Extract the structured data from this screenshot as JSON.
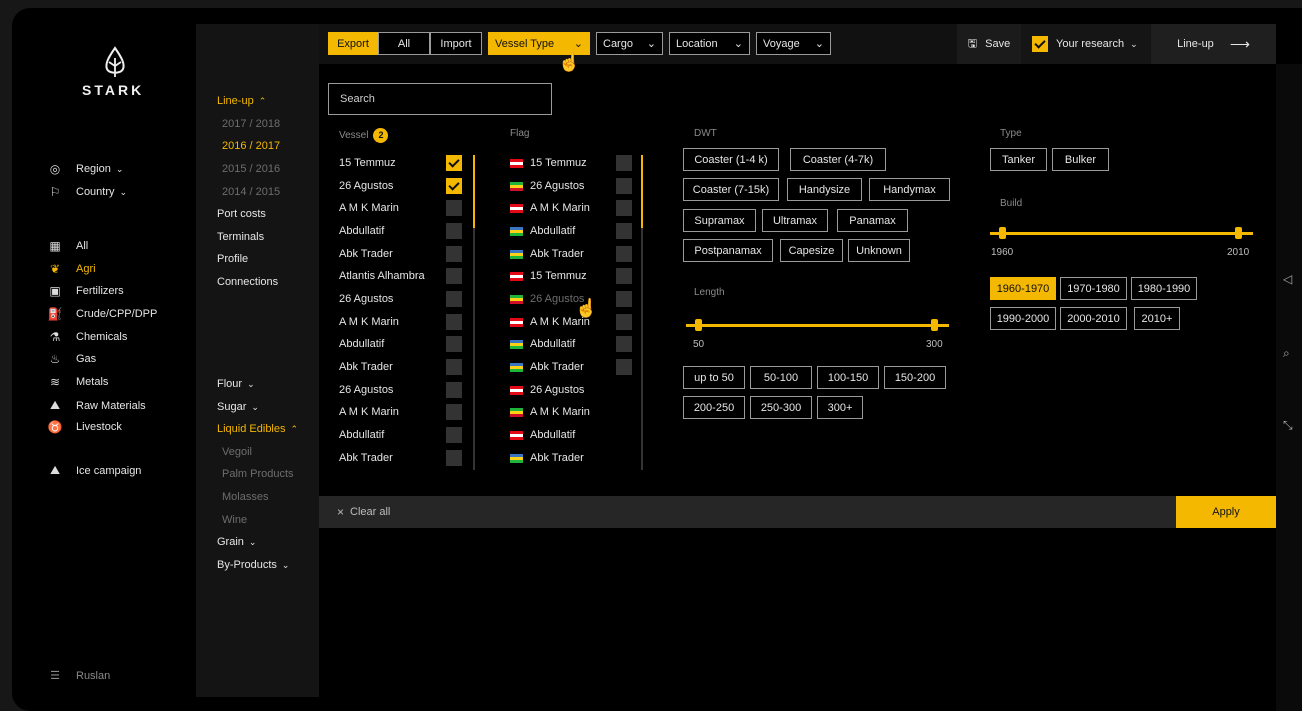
{
  "brand": {
    "name": "STARK"
  },
  "sidebar": {
    "region": "Region",
    "country": "Country",
    "items": [
      {
        "label": "All",
        "icon": "grid-icon"
      },
      {
        "label": "Agri",
        "icon": "wheat-icon"
      },
      {
        "label": "Fertilizers",
        "icon": "sack-icon"
      },
      {
        "label": "Crude/CPP/DPP",
        "icon": "oil-icon"
      },
      {
        "label": "Chemicals",
        "icon": "flask-icon"
      },
      {
        "label": "Gas",
        "icon": "flame-icon"
      },
      {
        "label": "Metals",
        "icon": "bars-icon"
      },
      {
        "label": "Raw Materials",
        "icon": "pile-icon"
      },
      {
        "label": "Livestock",
        "icon": "cow-icon"
      }
    ],
    "campaign": "Ice campaign",
    "user": "Ruslan"
  },
  "col2": {
    "lineup": "Line-up",
    "years": [
      "2017 / 2018",
      "2016 / 2017",
      "2015 / 2016",
      "2014 / 2015"
    ],
    "links": [
      "Port costs",
      "Terminals",
      "Profile",
      "Connections"
    ],
    "flour": "Flour",
    "sugar": "Sugar",
    "liquid": "Liquid Edibles",
    "liquid_items": [
      "Vegoil",
      "Palm Products",
      "Molasses",
      "Wine"
    ],
    "grain": "Grain",
    "byproducts": "By-Products"
  },
  "toolbar": {
    "export": "Export",
    "all": "All",
    "import": "Import",
    "vessel_type": "Vessel Type",
    "cargo": "Cargo",
    "location": "Location",
    "voyage": "Voyage",
    "save": "Save",
    "research": "Your research",
    "lineup": "Line-up"
  },
  "filters": {
    "search_placeholder": "Search",
    "vessel_header": "Vessel",
    "vessel_count": "2",
    "vessels": [
      "15 Temmuz",
      "26 Agustos",
      "A M K Marin",
      "Abdullatif",
      "Abk Trader",
      "Atlantis Alhambra",
      "26 Agustos",
      "A M K Marin",
      "Abdullatif",
      "Abk Trader",
      "26 Agustos",
      "A M K Marin",
      "Abdullatif",
      "Abk Trader"
    ],
    "flag_header": "Flag",
    "flags": [
      "15 Temmuz",
      "26 Agustos",
      "A M K Marin",
      "Abdullatif",
      "Abk Trader",
      "15 Temmuz",
      "26 Agustos",
      "A M K Marin",
      "Abdullatif",
      "Abk Trader",
      "26 Agustos",
      "A M K Marin",
      "Abdullatif",
      "Abk Trader"
    ],
    "dwt_header": "DWT",
    "dwt": [
      "Coaster (1-4 k)",
      "Coaster (4-7k)",
      "Coaster (7-15k)",
      "Handysize",
      "Handymax",
      "Supramax",
      "Ultramax",
      "Panamax",
      "Postpanamax",
      "Capesize",
      "Unknown"
    ],
    "length_header": "Length",
    "length_min": "50",
    "length_max": "300",
    "length_chips": [
      "up to 50",
      "50-100",
      "100-150",
      "150-200",
      "200-250",
      "250-300",
      "300+"
    ],
    "type_header": "Type",
    "types": [
      "Tanker",
      "Bulker"
    ],
    "build_header": "Build",
    "build_min": "1960",
    "build_max": "2010",
    "build_chips": [
      "1960-1970",
      "1970-1980",
      "1980-1990",
      "1990-2000",
      "2000-2010",
      "2010+"
    ],
    "clear_all": "Clear all",
    "apply": "Apply"
  },
  "colors": {
    "accent": "#f5b800",
    "background": "#000000"
  }
}
